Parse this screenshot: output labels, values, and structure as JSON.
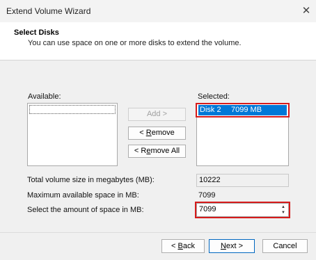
{
  "window": {
    "title": "Extend Volume Wizard",
    "close_glyph": "✕"
  },
  "header": {
    "title": "Select Disks",
    "subtitle": "You can use space on one or more disks to extend the volume."
  },
  "available": {
    "label": "Available:",
    "items": []
  },
  "selected": {
    "label": "Selected:",
    "items": [
      {
        "disk": "Disk 2",
        "size": "7099 MB"
      }
    ]
  },
  "buttons": {
    "add": "Add >",
    "remove": "< Remove",
    "remove_all": "< Remove All",
    "back": "< Back",
    "next": "Next >",
    "cancel": "Cancel"
  },
  "fields": {
    "total_label": "Total volume size in megabytes (MB):",
    "total_value": "10222",
    "max_label": "Maximum available space in MB:",
    "max_value": "7099",
    "amount_label": "Select the amount of space in MB:",
    "amount_value": "7099"
  },
  "colors": {
    "highlight": "#d61b1b",
    "selection": "#0078d7"
  }
}
